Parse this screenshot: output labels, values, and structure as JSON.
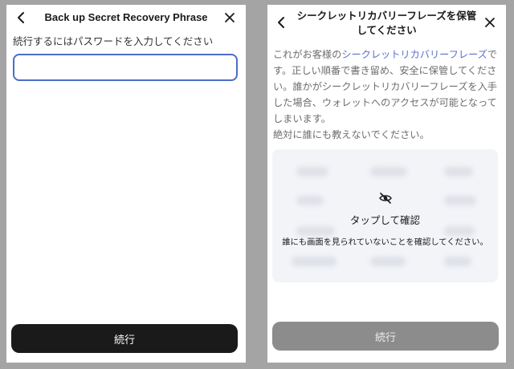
{
  "left": {
    "title": "Back up Secret Recovery Phrase",
    "password_label": "続行するにはパスワードを入力してください",
    "password_value": "",
    "continue_label": "続行",
    "back_icon": "chevron-left-icon",
    "close_icon": "close-icon"
  },
  "right": {
    "title_line1": "シークレットリカバリーフレーズを保管",
    "title_line2": "してください",
    "desc": {
      "line1_prefix": "これがお客様の",
      "line1_link": "シークレットリカバリーフレーズ",
      "line1_suffix": "で",
      "line2": "す。正しい順番で書き留め、安全に保管してくださ",
      "line3": "い。誰かがシークレットリカバリーフレーズを入手",
      "line4": "した場合、ウォレットへのアクセスが可能となって",
      "line5": "しまいます。",
      "line6": "絶対に誰にも教えないでください。"
    },
    "reveal": {
      "tap_label": "タップして確認",
      "warning": "誰にも画面を見られていないことを確認してください。",
      "icon": "eye-slash-icon"
    },
    "continue_label": "続行",
    "back_icon": "chevron-left-icon",
    "close_icon": "close-icon"
  },
  "colors": {
    "background": "#a4a4a4",
    "link": "#5b6fcf",
    "input_border": "#4a6ec8",
    "primary_button": "#1a1a1a",
    "disabled_button": "#8c8c8c"
  }
}
